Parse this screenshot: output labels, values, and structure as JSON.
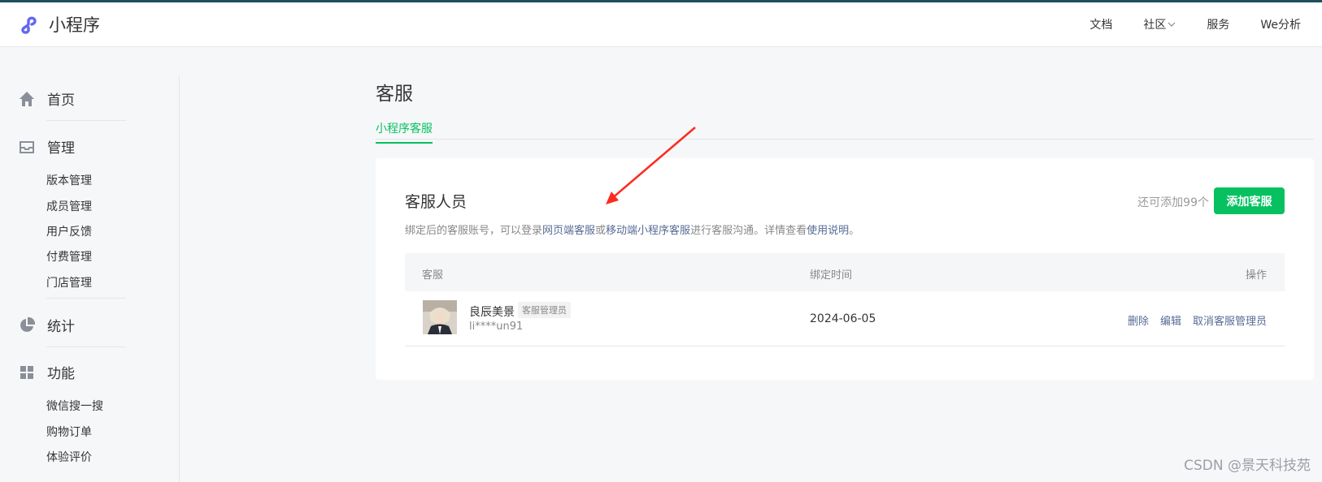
{
  "colors": {
    "accent": "#07c160",
    "link": "#576b95",
    "arrow": "#ff2a1f",
    "topbar": "#1f4e5f"
  },
  "app": {
    "logo_text": "小程序",
    "logo_icon": "mini-program-logo-icon"
  },
  "topnav": {
    "items": [
      "文档",
      "社区",
      "服务",
      "We分析"
    ]
  },
  "sidebar": {
    "sections": [
      {
        "label": "首页",
        "icon": "home-icon",
        "items": []
      },
      {
        "label": "管理",
        "icon": "inbox-icon",
        "items": [
          "版本管理",
          "成员管理",
          "用户反馈",
          "付费管理",
          "门店管理"
        ]
      },
      {
        "label": "统计",
        "icon": "pie-chart-icon",
        "items": []
      },
      {
        "label": "功能",
        "icon": "grid-icon",
        "items": [
          "微信搜一搜",
          "购物订单",
          "体验评价"
        ]
      }
    ]
  },
  "page": {
    "title": "客服",
    "tabs": [
      "小程序客服"
    ]
  },
  "card": {
    "title": "客服人员",
    "quota_text": "还可添加99个",
    "add_button": "添加客服",
    "desc": {
      "part1": "绑定后的客服账号，可以登录",
      "link1": "网页端客服",
      "part2": "或",
      "link2": "移动端小程序客服",
      "part3": "进行客服沟通。详情查看",
      "link3": "使用说明",
      "part4": "。"
    },
    "table": {
      "headers": [
        "客服",
        "绑定时间",
        "操作"
      ],
      "rows": [
        {
          "name": "良辰美景",
          "role": "客服管理员",
          "account": "li****un91",
          "date": "2024-06-05",
          "actions": [
            "删除",
            "编辑",
            "取消客服管理员"
          ]
        }
      ]
    }
  },
  "watermark": "CSDN @景天科技苑"
}
